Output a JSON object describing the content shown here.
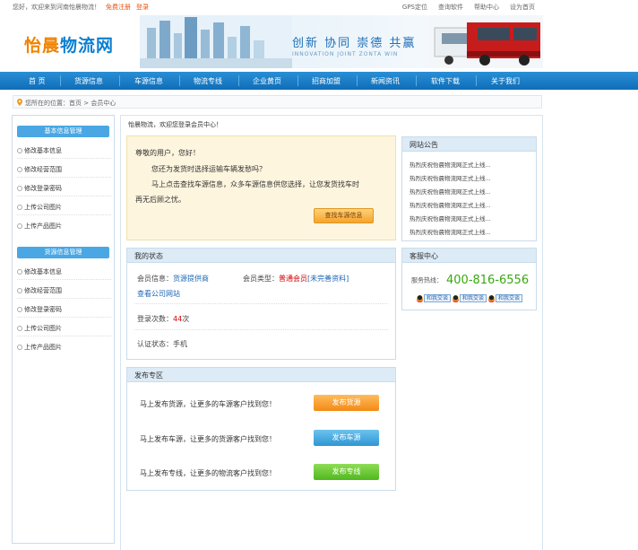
{
  "topbar": {
    "welcome": "您好，欢迎来到河南怡晨物流！",
    "register": "免费注册",
    "login": "登录",
    "links": [
      "GPS定位",
      "查询软件",
      "帮助中心",
      "设为首页"
    ]
  },
  "logo": {
    "text1": "怡晨",
    "text2": "物流网"
  },
  "banner": {
    "slogan": "创新 协同 崇德 共赢",
    "slogan_en": "INNOVATION  JOINT  ZONTA  WIN"
  },
  "nav": [
    "首 页",
    "货源信息",
    "车源信息",
    "物流专线",
    "企业黄页",
    "招商加盟",
    "新闻资讯",
    "软件下载",
    "关于我们"
  ],
  "breadcrumb": "您所在的位置：首页 > 会员中心",
  "sidebar": {
    "group1": {
      "title": "基本信息管理",
      "items": [
        "修改基本信息",
        "修改经营范围",
        "修改登录密码",
        "上传公司图片",
        "上传产品图片"
      ]
    },
    "group2": {
      "title": "货源信息管理",
      "items": [
        "修改基本信息",
        "修改经营范围",
        "修改登录密码",
        "上传公司图片",
        "上传产品图片"
      ]
    }
  },
  "main": {
    "welcome": "怡晨物流，欢迎您登录会员中心！",
    "greet": {
      "line1": "尊敬的用户，您好！",
      "line2": "您还为发货时选择运输车辆发愁吗？",
      "line3": "马上点击查找车源信息，众多车源信息供您选择，让您发货找车时",
      "line4": "再无后顾之忧。",
      "button": "查找车源信息"
    },
    "status": {
      "title": "我的状态",
      "member_label": "会员信息：",
      "member_value": "货源提供商",
      "type_label": "会员类型：",
      "type_value": "普通会员",
      "type_extra": "[未完善资料]",
      "view_company": "查看公司网站",
      "login_label": "登录次数：",
      "login_count": "44",
      "login_unit": "次",
      "auth_label": "认证状态：",
      "auth_value": "手机"
    },
    "publish": {
      "title": "发布专区",
      "rows": [
        {
          "text": "马上发布货源，让更多的车源客户找到您！",
          "button": "发布货源"
        },
        {
          "text": "马上发布车源，让更多的货源客户找到您！",
          "button": "发布车源"
        },
        {
          "text": "马上发布专线，让更多的物流客户找到您！",
          "button": "发布专线"
        }
      ]
    }
  },
  "notice": {
    "title": "网站公告",
    "items": [
      "热烈庆祝怡晨物流网正式上线...",
      "热烈庆祝怡晨物流网正式上线...",
      "热烈庆祝怡晨物流网正式上线...",
      "热烈庆祝怡晨物流网正式上线...",
      "热烈庆祝怡晨物流网正式上线...",
      "热烈庆祝怡晨物流网正式上线..."
    ]
  },
  "service": {
    "title": "客服中心",
    "hotline_label": "服务热线：",
    "hotline": "400-816-6556",
    "qq_label": "和我交谈"
  },
  "colors": {
    "nav": "#0f6db7",
    "accent": "#f08300",
    "hotline": "#37a90f"
  }
}
